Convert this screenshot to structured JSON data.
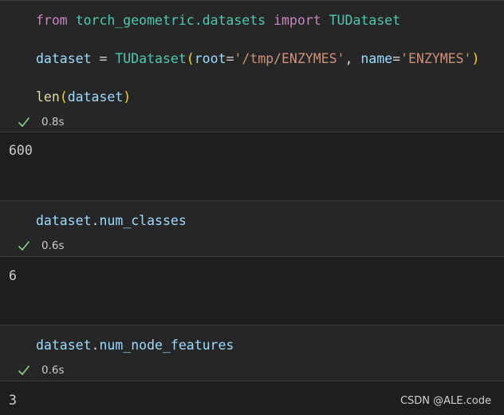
{
  "cells": [
    {
      "code": {
        "line1": {
          "kw_from": "from",
          "module": "torch_geometric.datasets",
          "kw_import": "import",
          "cls": "TUDataset"
        },
        "line2": {
          "var": "dataset",
          "eq": " = ",
          "cls": "TUDataset",
          "lp": "(",
          "arg1": "root",
          "eq1": "=",
          "val1": "'/tmp/ENZYMES'",
          "comma": ", ",
          "arg2": "name",
          "eq2": "=",
          "val2": "'ENZYMES'",
          "rp": ")"
        },
        "line3": {
          "fn": "len",
          "lp": "(",
          "var": "dataset",
          "rp": ")"
        }
      },
      "status": {
        "icon": "check-icon",
        "time": "0.8s"
      },
      "output": "600"
    },
    {
      "code": {
        "obj": "dataset",
        "dot": ".",
        "attr": "num_classes"
      },
      "status": {
        "icon": "check-icon",
        "time": "0.6s"
      },
      "output": "6"
    },
    {
      "code": {
        "obj": "dataset",
        "dot": ".",
        "attr": "num_node_features"
      },
      "status": {
        "icon": "check-icon",
        "time": "0.6s"
      },
      "output": "3"
    }
  ],
  "watermark": "CSDN @ALE.code",
  "colors": {
    "background": "#1e1e1e",
    "cell_background": "#262626",
    "check": "#89d185"
  }
}
